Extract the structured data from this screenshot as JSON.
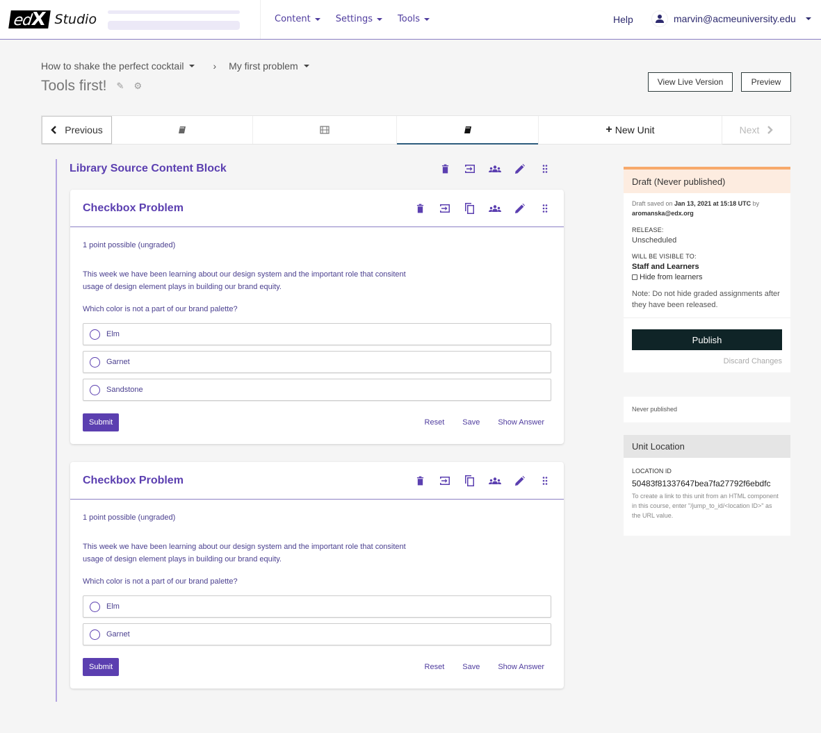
{
  "header": {
    "logo_text": "edX",
    "app_name": "Studio",
    "nav": [
      {
        "label": "Content",
        "icon": "caret-down-icon"
      },
      {
        "label": "Settings",
        "icon": "caret-down-icon"
      },
      {
        "label": "Tools",
        "icon": "caret-down-icon"
      }
    ],
    "help": "Help",
    "user": "marvin@acmeuniversity.edu"
  },
  "breadcrumb": {
    "section": "How to shake the perfect cocktail",
    "separator": "›",
    "subsection": "My first problem"
  },
  "unit": {
    "title": "Tools first!",
    "view_live": "View Live Version",
    "preview": "Preview"
  },
  "unit_nav": {
    "previous": "Previous",
    "tabs": [
      {
        "icon": "book-icon",
        "active": false
      },
      {
        "icon": "film-icon",
        "active": false
      },
      {
        "icon": "book-icon",
        "active": true
      }
    ],
    "new_unit": "New Unit",
    "next": "Next"
  },
  "library_block": {
    "title": "Library Source Content Block",
    "icons": [
      "trash-icon",
      "move-icon",
      "groups-icon",
      "edit-icon",
      "drag-handle-icon"
    ]
  },
  "problems": [
    {
      "title": "Checkbox Problem",
      "icons": [
        "trash-icon",
        "move-icon",
        "copy-icon",
        "groups-icon",
        "edit-icon",
        "drag-handle-icon"
      ],
      "points": "1 point possible (ungraded)",
      "text": "This week we have been learning about our design system and the important role that consitent usage of design element plays in building our brand equity.",
      "question": "Which color is not a part of our brand palette?",
      "options": [
        "Elm",
        "Garnet",
        "Sandstone"
      ],
      "submit": "Submit",
      "reset": "Reset",
      "save": "Save",
      "show_answer": "Show Answer"
    },
    {
      "title": "Checkbox Problem",
      "icons": [
        "trash-icon",
        "move-icon",
        "copy-icon",
        "groups-icon",
        "edit-icon",
        "drag-handle-icon"
      ],
      "points": "1 point possible (ungraded)",
      "text": "This week we have been learning about our design system and the important role that consitent usage of design element plays in building our brand equity.",
      "question": "Which color is not a part of our brand palette?",
      "options": [
        "Elm",
        "Garnet"
      ],
      "submit": "Submit",
      "reset": "Reset",
      "save": "Save",
      "show_answer": "Show Answer"
    }
  ],
  "status_panel": {
    "title": "Draft (Never published)",
    "saved_prefix": "Draft saved on",
    "saved_date": "Jan 13, 2021 at 15:18 UTC",
    "saved_by": "by",
    "saved_user": "aromanska@edx.org",
    "release_label": "RELEASE:",
    "release_value": "Unscheduled",
    "visible_label": "WILL BE VISIBLE TO:",
    "visible_value": "Staff and Learners",
    "hide_label": "Hide from learners",
    "hide_checked": false,
    "note": "Note: Do not hide graded assignments after they have been released.",
    "publish": "Publish",
    "discard": "Discard Changes",
    "colors": {
      "accent": "#f7a96b",
      "publish_bg": "#0f2427"
    }
  },
  "publish_history": "Never published",
  "location_panel": {
    "title": "Unit Location",
    "label": "LOCATION ID",
    "id": "50483f81337647bea7fa27792f6ebdfc",
    "help": "To create a link to this unit from an HTML component in this course, enter \"/jump_to_id/<location ID>\" as the URL value."
  },
  "colors": {
    "brand": "#5b3fb0",
    "nav_text": "#4f3c9e"
  }
}
